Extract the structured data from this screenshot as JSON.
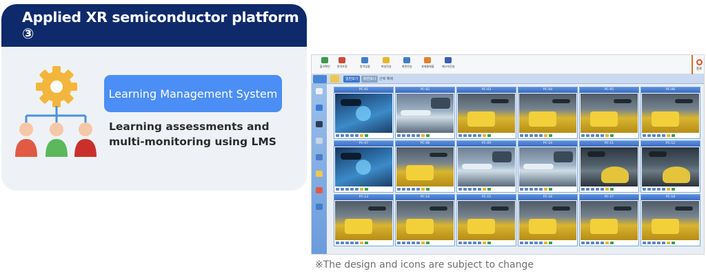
{
  "card": {
    "title": "Applied XR semiconductor platform ③",
    "lms_label": "Learning Management System",
    "description": "Learning assessments and multi-monitoring using LMS",
    "icon": "organization-gear-icon"
  },
  "app": {
    "toolbar_items": [
      {
        "label": "출석확인",
        "icon": "attendance-icon",
        "color": "#3a9a4a"
      },
      {
        "label": "원격조정",
        "icon": "remote-icon",
        "color": "#c94b3b"
      },
      {
        "label": "원격일괄",
        "icon": "network-icon",
        "color": "#3f7fc4"
      },
      {
        "label": "파일전송",
        "icon": "folder-icon",
        "color": "#e7b62a"
      },
      {
        "label": "화면전송",
        "icon": "monitor-share-icon",
        "color": "#3f7fc4"
      },
      {
        "label": "과제물제출",
        "icon": "assignment-icon",
        "color": "#e0822b"
      },
      {
        "label": "메시지전송",
        "icon": "message-icon",
        "color": "#3a5fb0"
      }
    ],
    "power_label": "종료",
    "subbar": {
      "chip1": "일반보기",
      "chip2": "화면모니",
      "text": "선택 해제"
    },
    "sidebar_icons": [
      "clipboard-icon",
      "globe-icon",
      "book-icon",
      "link-icon",
      "chat-icon",
      "folder-icon",
      "stack-icon",
      "network-icon"
    ],
    "pcs": [
      {
        "name": "PC-01",
        "scene": "blue"
      },
      {
        "name": "PC-02",
        "scene": "lab"
      },
      {
        "name": "PC-03",
        "scene": "yellow"
      },
      {
        "name": "PC-04",
        "scene": "yellow"
      },
      {
        "name": "PC-05",
        "scene": "yellow"
      },
      {
        "name": "PC-06",
        "scene": "yellow"
      },
      {
        "name": "PC-07",
        "scene": "blue"
      },
      {
        "name": "PC-08",
        "scene": "yellow"
      },
      {
        "name": "PC-09",
        "scene": "lab"
      },
      {
        "name": "PC-10",
        "scene": "lab"
      },
      {
        "name": "PC-11",
        "scene": "dark"
      },
      {
        "name": "PC-12",
        "scene": "dark"
      },
      {
        "name": "PC-13",
        "scene": "yellow"
      },
      {
        "name": "PC-14",
        "scene": "yellow"
      },
      {
        "name": "PC-15",
        "scene": "yellow"
      },
      {
        "name": "PC-16",
        "scene": "yellow"
      },
      {
        "name": "PC-17",
        "scene": "yellow"
      },
      {
        "name": "PC-18",
        "scene": "yellow"
      }
    ]
  },
  "disclaimer": "※The design and icons are subject to change"
}
